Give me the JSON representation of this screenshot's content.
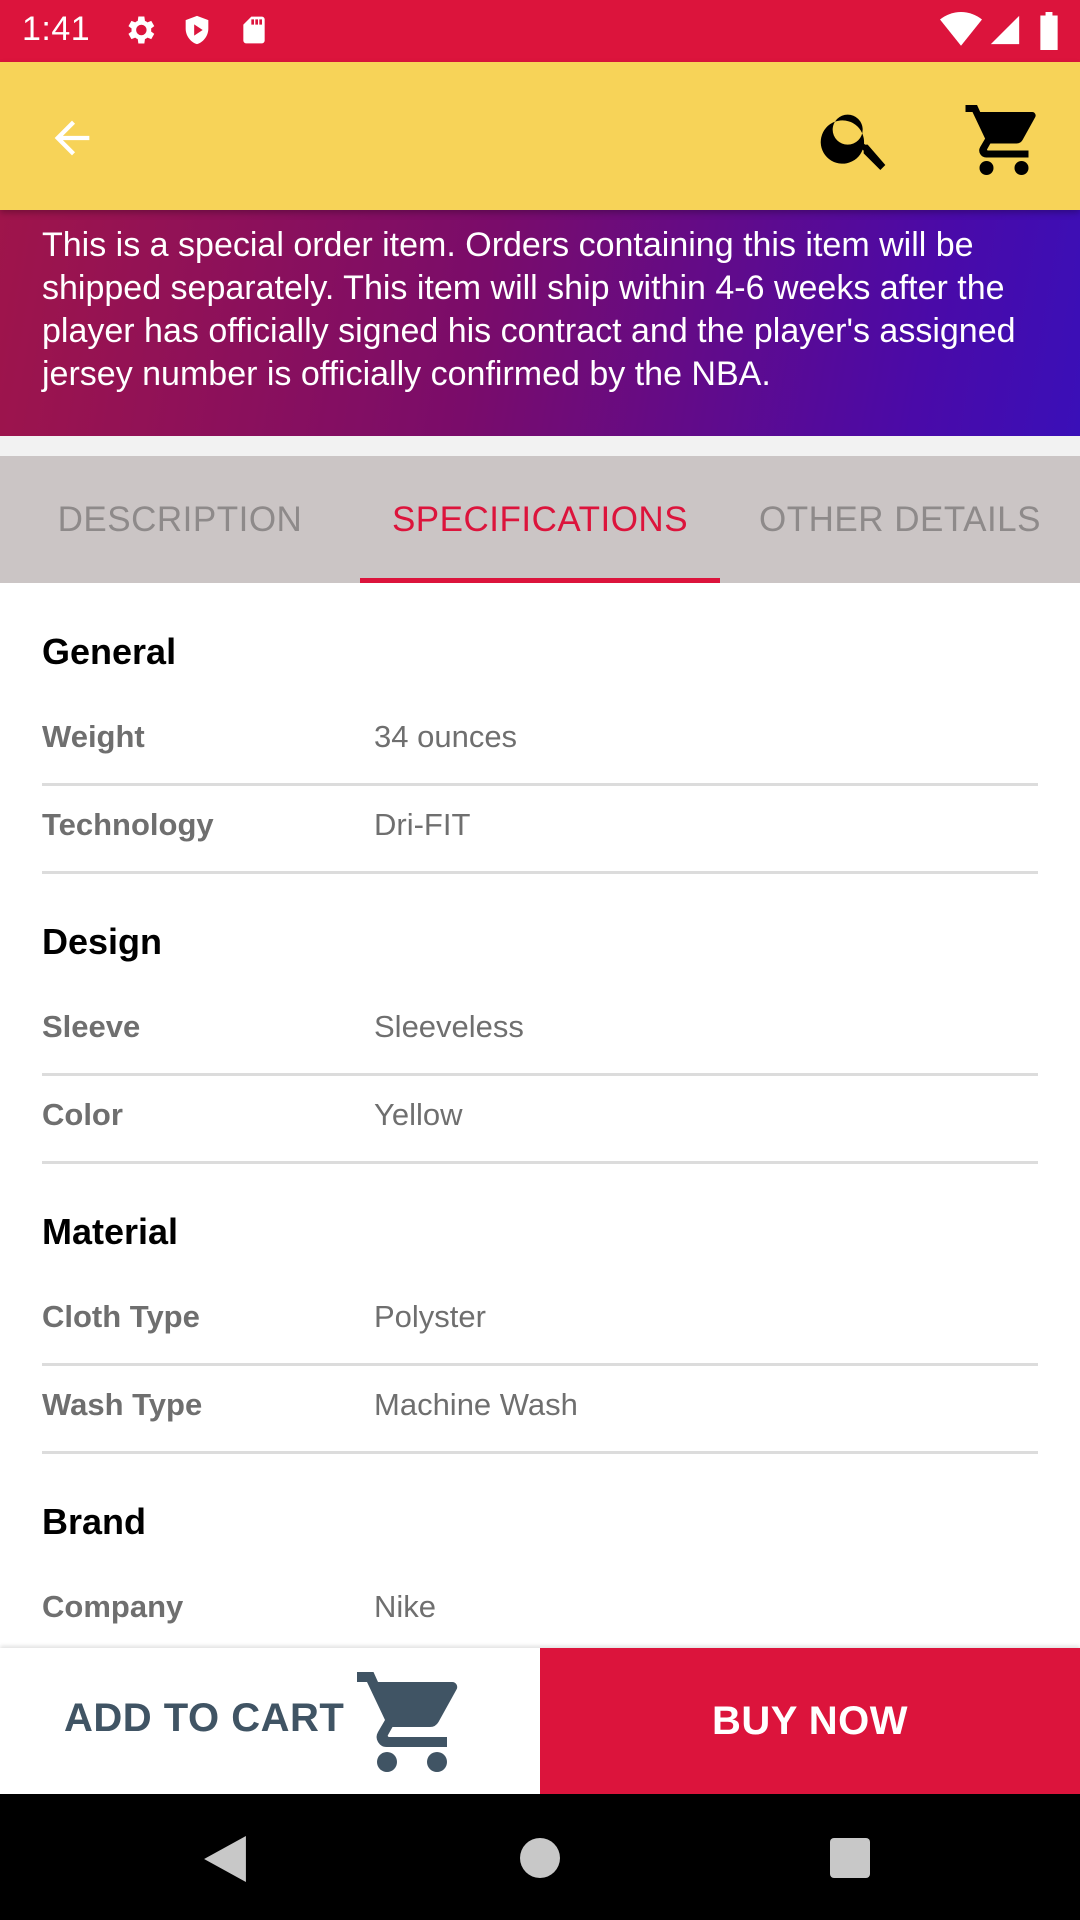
{
  "status_bar": {
    "time": "1:41",
    "icons": [
      "gear-icon",
      "shield-icon",
      "sd-card-icon",
      "wifi-icon",
      "signal-icon",
      "battery-icon"
    ]
  },
  "app_bar": {
    "icons": [
      "back-arrow-icon",
      "search-icon",
      "cart-icon"
    ]
  },
  "notice": {
    "text": "This is a special order item. Orders containing this item will be shipped separately. This item will ship within 4-6 weeks after the player has officially signed his contract and the player's assigned jersey number is officially confirmed by the NBA."
  },
  "tabs": [
    {
      "label": "DESCRIPTION"
    },
    {
      "label": "SPECIFICATIONS"
    },
    {
      "label": "OTHER DETAILS"
    }
  ],
  "active_tab": "SPECIFICATIONS",
  "specs": {
    "general": {
      "title": "General",
      "rows": [
        {
          "key": "Weight",
          "value": "34 ounces"
        },
        {
          "key": "Technology",
          "value": "Dri-FIT"
        }
      ]
    },
    "design": {
      "title": "Design",
      "rows": [
        {
          "key": "Sleeve",
          "value": "Sleeveless"
        },
        {
          "key": "Color",
          "value": "Yellow"
        }
      ]
    },
    "material": {
      "title": "Material",
      "rows": [
        {
          "key": "Cloth Type",
          "value": "Polyster"
        },
        {
          "key": "Wash Type",
          "value": "Machine Wash"
        }
      ]
    },
    "brand": {
      "title": "Brand",
      "rows": [
        {
          "key": "Company",
          "value": "Nike"
        }
      ]
    }
  },
  "actions": {
    "add_to_cart": "ADD TO CART",
    "buy_now": "BUY NOW"
  },
  "colors": {
    "accent": "#dc143c",
    "app_bar": "#f7d358",
    "tab_bg": "#cbc5c5",
    "add_to_cart_text": "#405464"
  },
  "nav_bar": {
    "icons": [
      "back-triangle-icon",
      "home-circle-icon",
      "recents-square-icon"
    ]
  }
}
